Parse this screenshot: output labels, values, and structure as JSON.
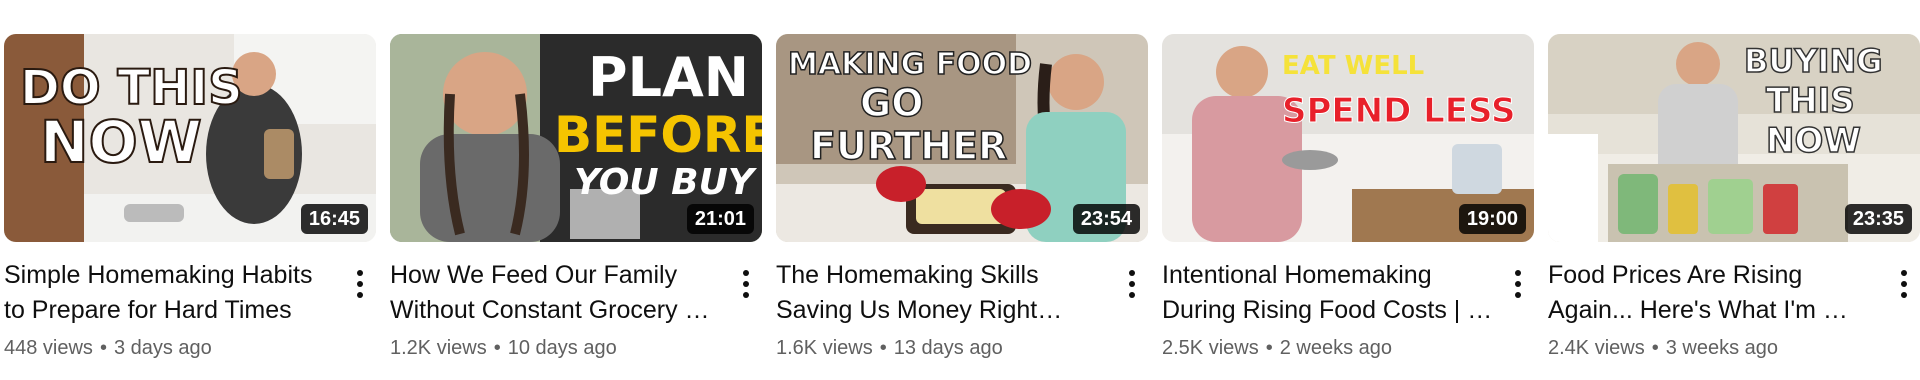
{
  "videos": [
    {
      "title": "Simple Homemaking Habits to Prepare for Hard Times",
      "duration": "16:45",
      "views": "448 views",
      "age": "3 days ago",
      "thumb_text": [
        "DO THIS",
        "NOW"
      ]
    },
    {
      "title": "How We Feed Our Family Without Constant Grocery …",
      "duration": "21:01",
      "views": "1.2K views",
      "age": "10 days ago",
      "thumb_text": [
        "PLAN",
        "BEFORE",
        "YOU BUY"
      ]
    },
    {
      "title": "The Homemaking Skills Saving Us Money Right Now…",
      "duration": "23:54",
      "views": "1.6K views",
      "age": "13 days ago",
      "thumb_text": [
        "MAKING FOOD",
        "GO",
        "FURTHER"
      ]
    },
    {
      "title": "Intentional Homemaking During Rising Food Costs | …",
      "duration": "19:00",
      "views": "2.5K views",
      "age": "2 weeks ago",
      "thumb_text": [
        "EAT WELL",
        "SPEND LESS"
      ]
    },
    {
      "title": "Food Prices Are Rising Again... Here's What I'm …",
      "duration": "23:35",
      "views": "2.4K views",
      "age": "3 weeks ago",
      "thumb_text": [
        "BUYING",
        "THIS",
        "NOW"
      ]
    }
  ],
  "separator": "•",
  "colors": {
    "text_primary": "#0f0f0f",
    "text_secondary": "#606060",
    "duration_bg": "#000000",
    "accent_yellow": "#f5c400",
    "accent_red": "#e8202a"
  }
}
